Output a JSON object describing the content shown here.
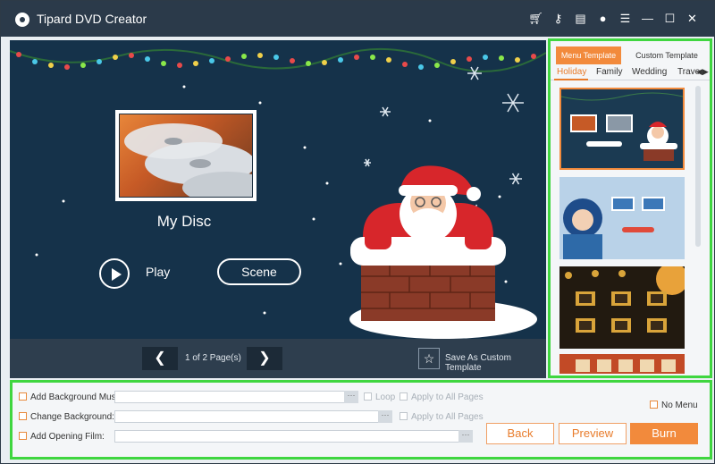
{
  "app": {
    "title": "Tipard DVD Creator"
  },
  "titlebar": {
    "icons": [
      "cart-icon",
      "key-icon",
      "save-icon",
      "chat-icon",
      "menu-icon",
      "minimize-icon",
      "maximize-icon",
      "close-icon"
    ]
  },
  "preview": {
    "disc_title": "My Disc",
    "play_label": "Play",
    "scene_label": "Scene",
    "page_indicator": "1 of 2 Page(s)",
    "save_template_label": "Save As Custom Template"
  },
  "templates": {
    "tabs": [
      "Menu Template",
      "Custom Template"
    ],
    "categories": [
      "Holiday",
      "Family",
      "Wedding",
      "Trave"
    ],
    "selected_index": 0
  },
  "options": {
    "add_bg_music": "Add Background Music:",
    "change_bg": "Change Background:",
    "add_opening_film": "Add Opening Film:",
    "loop": "Loop",
    "apply_all_1": "Apply to All Pages",
    "apply_all_2": "Apply to All Pages",
    "no_menu": "No Menu",
    "dots": "···"
  },
  "buttons": {
    "back": "Back",
    "preview": "Preview",
    "burn": "Burn"
  },
  "colors": {
    "accent": "#F28A3C",
    "highlight": "#3FD63F",
    "titlebar": "#2B3A4A",
    "preview_bg": "#15324A"
  }
}
